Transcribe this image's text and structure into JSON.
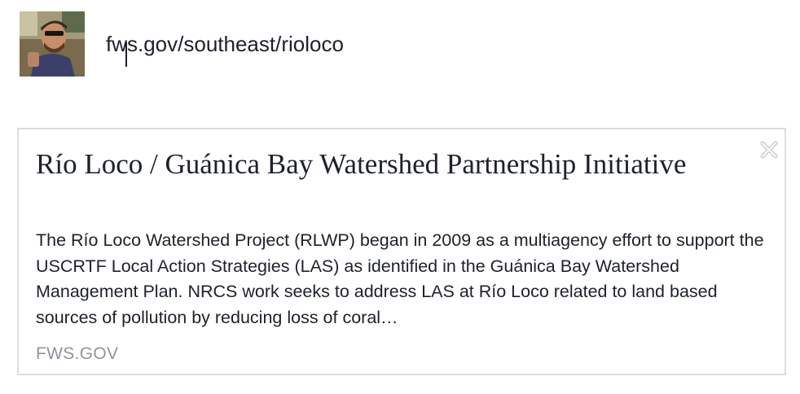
{
  "composer": {
    "avatar_icon": "user-avatar-photo",
    "input_value": "fws.gov/southeast/rioloco"
  },
  "link_preview": {
    "title": "Río Loco / Guánica Bay Watershed Partnership Initiative",
    "description": "The Río Loco Watershed Project (RLWP) began in 2009 as a multiagency effort to support the USCRTF Local Action Strategies (LAS) as identified in the Guánica Bay Watershed Management Plan. NRCS work seeks to address LAS at Río Loco related to land based sources of pollution by reducing loss of coral…",
    "domain": "FWS.GOV",
    "close_icon": "close-icon"
  },
  "colors": {
    "text": "#1d2129",
    "muted": "#90949c",
    "border": "#dadde1",
    "close": "#c8cbd0"
  }
}
